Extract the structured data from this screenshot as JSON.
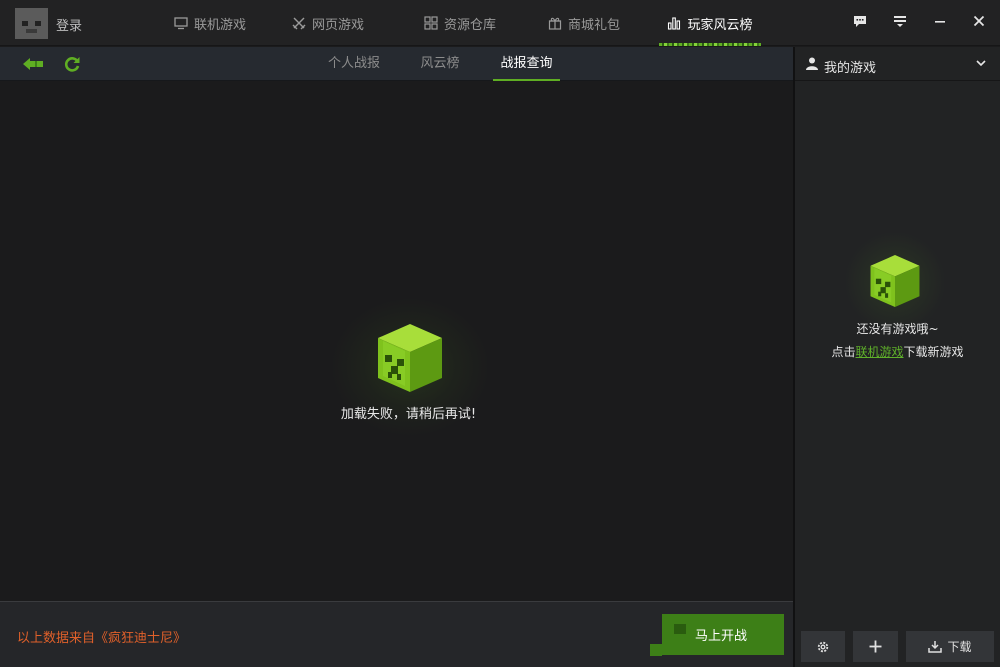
{
  "header": {
    "login_label": "登录",
    "nav": [
      {
        "label": "联机游戏",
        "icon": "monitor-icon"
      },
      {
        "label": "网页游戏",
        "icon": "crossed-swords-icon"
      },
      {
        "label": "资源仓库",
        "icon": "grid-icon"
      },
      {
        "label": "商城礼包",
        "icon": "gift-icon"
      },
      {
        "label": "玩家风云榜",
        "icon": "bar-chart-icon",
        "active": true
      }
    ],
    "window_controls": [
      "chat-icon",
      "skin-icon",
      "minimize-icon",
      "close-icon"
    ]
  },
  "toolbar": {
    "tabs": [
      {
        "label": "个人战报"
      },
      {
        "label": "风云榜"
      },
      {
        "label": "战报查询",
        "active": true
      }
    ]
  },
  "main": {
    "error_message": "加载失败，请稍后再试!"
  },
  "footer": {
    "source_text": "以上数据来自《疯狂迪士尼》",
    "start_button": "马上开战"
  },
  "sidebar": {
    "title": "我的游戏",
    "empty_text": "还没有游戏哦~",
    "hint_prefix": "点击",
    "hint_link": "联机游戏",
    "hint_suffix": "下载新游戏",
    "download_label": "下载"
  },
  "colors": {
    "accent_green": "#5fae23",
    "source_orange": "#e0602a",
    "button_green": "#3d7f17"
  }
}
